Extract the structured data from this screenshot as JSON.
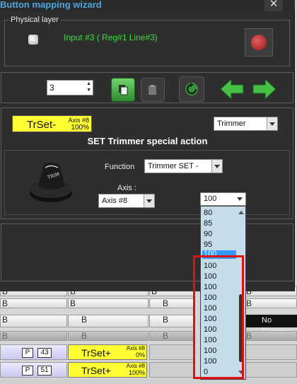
{
  "window": {
    "title": "Button mapping wizard",
    "close": "✕"
  },
  "physical": {
    "legend": "Physical layer",
    "input_label": "Input #3 ( Reg#1  Line#3)"
  },
  "toolbar": {
    "spin_value": "3",
    "icons": [
      "copy-icon",
      "paste-icon",
      "reset-icon",
      "arrow-left-icon",
      "arrow-right-icon"
    ]
  },
  "action": {
    "tag_main": "TrSet-",
    "tag_axis": "Axis #8",
    "tag_pct": "100%",
    "type_select": "Trimmer",
    "title": "SET Trimmer special action",
    "function_label": "Function",
    "function_value": "Trimmer SET -",
    "axis_label": "Axis :",
    "axis_value": "Axis #8",
    "percent_value": "100"
  },
  "dropdown": {
    "items": [
      "80",
      "85",
      "90",
      "95",
      "100",
      "100",
      "100",
      "100",
      "100",
      "100",
      "100",
      "100",
      "100",
      "100",
      "100",
      "0"
    ],
    "selected_index": 4
  },
  "background_table": {
    "row_letters": [
      "B",
      "B",
      "B",
      "B"
    ],
    "no_function": "No Function",
    "rows": [
      {
        "p": "P",
        "num": "43",
        "label": "TrSet+",
        "axis": "Axis #8",
        "pct": "0%"
      },
      {
        "p": "P",
        "num": "51",
        "label": "TrSet+",
        "axis": "Axis #8",
        "pct": "100%"
      }
    ]
  },
  "colors": {
    "accent_title": "#4aa6e0",
    "input_label": "#39e039",
    "highlight": "#e01010",
    "tag_yellow": "#ffff33"
  }
}
